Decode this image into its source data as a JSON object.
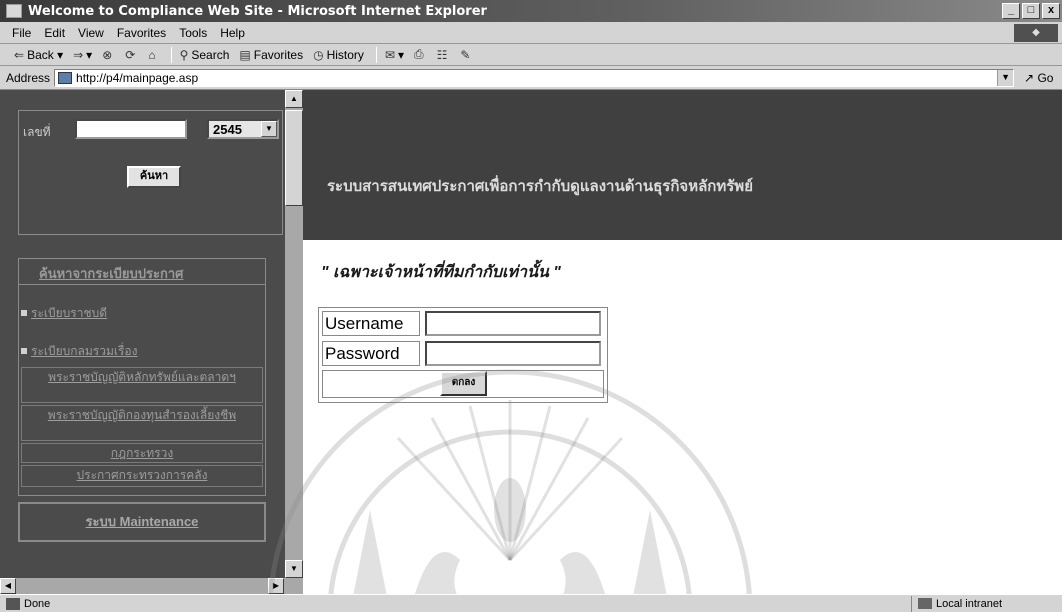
{
  "window": {
    "title": "Welcome to Compliance Web Site - Microsoft Internet Explorer",
    "controls": [
      "_",
      "□",
      "x"
    ]
  },
  "menu": {
    "items": [
      "File",
      "Edit",
      "View",
      "Favorites",
      "Tools",
      "Help"
    ]
  },
  "toolbar": {
    "back": "Back",
    "search": "Search",
    "favorites": "Favorites",
    "history": "History"
  },
  "address": {
    "label": "Address",
    "url": "http://p4/mainpage.asp",
    "go": "Go"
  },
  "sidebar": {
    "search_label": "เลขที่",
    "search_value": "",
    "year": "2545",
    "search_button": "ค้นหา",
    "header": "ค้นหาจากระเบียบประกาศ",
    "links": [
      "ระเบียบราชบดี",
      "ระเบียบกลมรวมเรื่อง",
      "พระราชบัญญัติหลักทรัพย์และตลาดฯ",
      "พระราชบัญญัติกองทุนสำรองเลี้ยงชีพ",
      "กฎกระทรวง",
      "ประกาศกระทรวงการคลัง"
    ],
    "maintenance": "ระบบ Maintenance"
  },
  "main": {
    "banner": "ระบบสารสนเทศประกาศเพื่อการกำกับดูแลงานด้านธุรกิจหลักทรัพย์",
    "note": "\" เฉพาะเจ้าหน้าที่ทีมกำกับเท่านั้น \"",
    "username_label": "Username",
    "password_label": "Password",
    "username_value": "",
    "password_value": "",
    "ok_button": "ตกลง"
  },
  "status": {
    "text": "Done",
    "zone": "Local intranet"
  }
}
